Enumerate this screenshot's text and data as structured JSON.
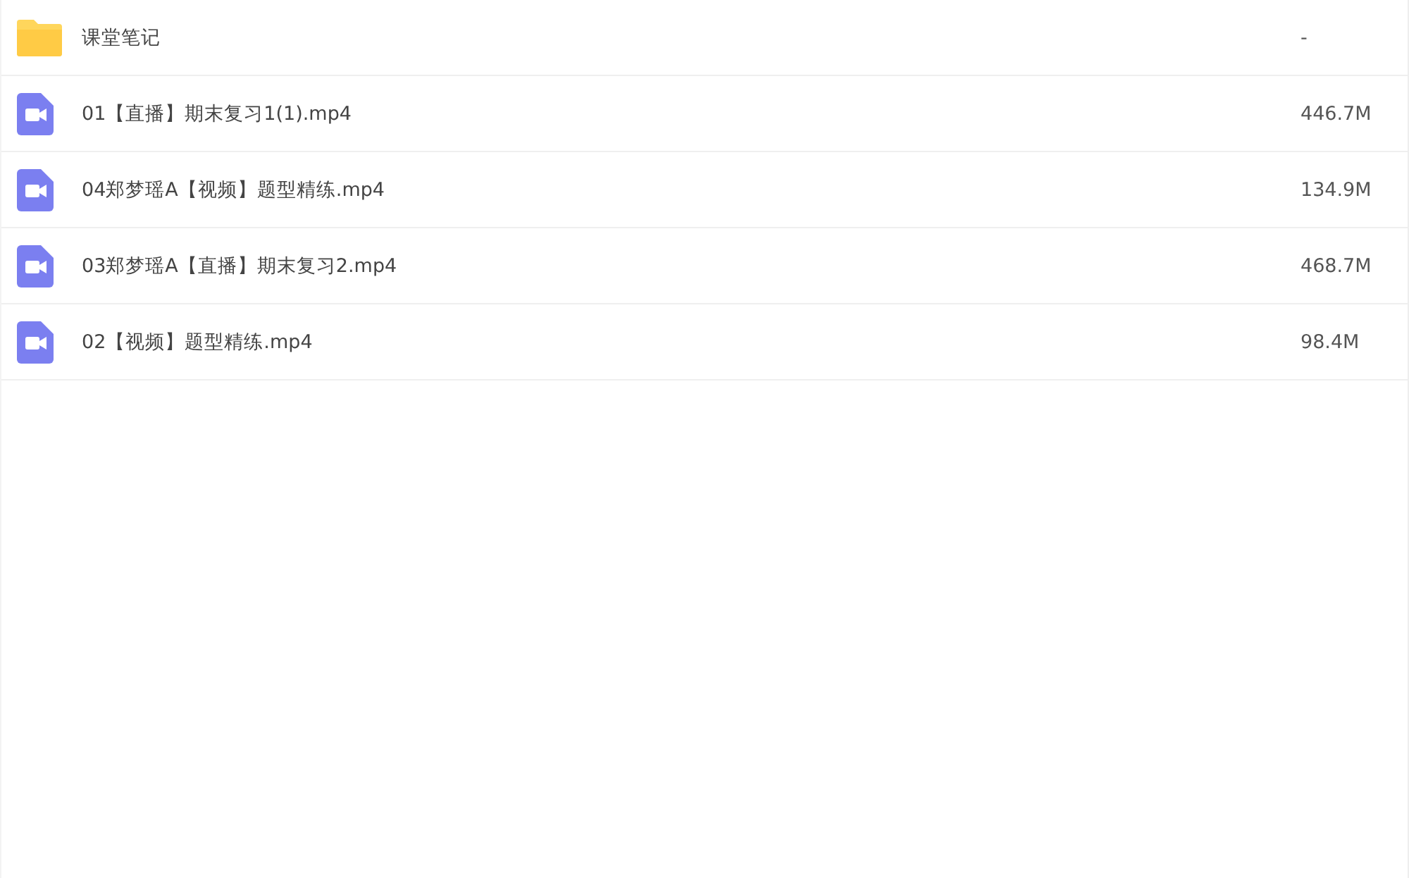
{
  "files": [
    {
      "kind": "folder",
      "name": "课堂笔记",
      "size": "-"
    },
    {
      "kind": "video",
      "name": "01【直播】期末复习1(1).mp4",
      "size": "446.7M"
    },
    {
      "kind": "video",
      "name": "04郑梦瑶A【视频】题型精练.mp4",
      "size": "134.9M"
    },
    {
      "kind": "video",
      "name": "03郑梦瑶A【直播】期末复习2.mp4",
      "size": "468.7M"
    },
    {
      "kind": "video",
      "name": "02【视频】题型精练.mp4",
      "size": "98.4M"
    }
  ]
}
